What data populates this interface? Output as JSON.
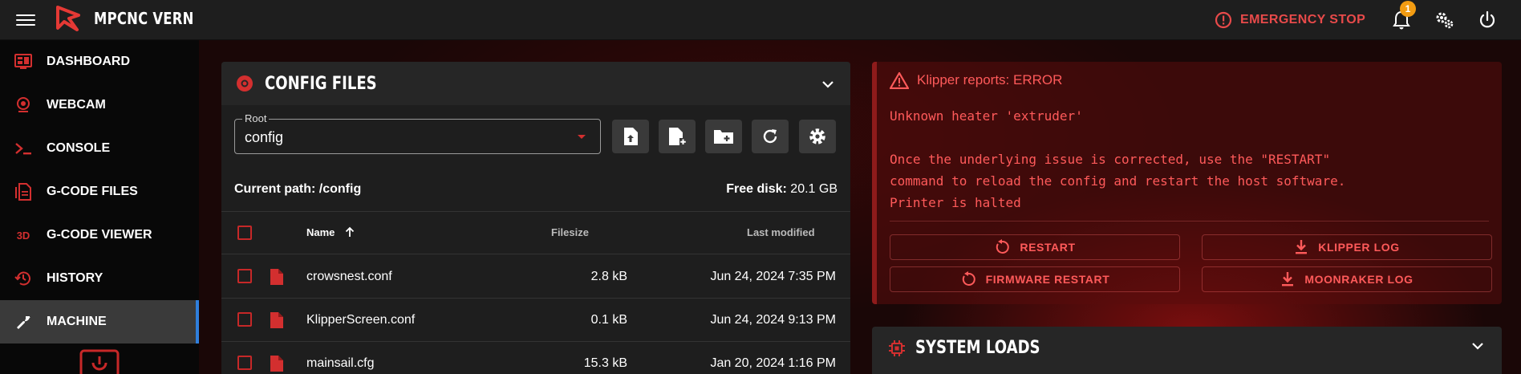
{
  "app": {
    "title": "MPCNC VERN"
  },
  "topbar": {
    "emergency_label": "EMERGENCY STOP",
    "notification_count": "1"
  },
  "sidebar": {
    "items": [
      {
        "label": "DASHBOARD",
        "icon": "dashboard-icon"
      },
      {
        "label": "WEBCAM",
        "icon": "webcam-icon"
      },
      {
        "label": "CONSOLE",
        "icon": "console-icon"
      },
      {
        "label": "G-CODE FILES",
        "icon": "gcode-files-icon"
      },
      {
        "label": "G-CODE VIEWER",
        "icon": "3d-icon",
        "icon_text": "3D"
      },
      {
        "label": "HISTORY",
        "icon": "history-icon"
      },
      {
        "label": "MACHINE",
        "icon": "wrench-icon",
        "active": true
      }
    ]
  },
  "config_panel": {
    "title": "CONFIG FILES",
    "root_label": "Root",
    "root_value": "config",
    "path_label": "Current path:",
    "path_value": "/config",
    "disk_label": "Free disk:",
    "disk_value": "20.1 GB",
    "columns": {
      "name": "Name",
      "size": "Filesize",
      "modified": "Last modified"
    },
    "files": [
      {
        "name": "crowsnest.conf",
        "size": "2.8 kB",
        "modified": "Jun 24, 2024 7:35 PM"
      },
      {
        "name": "KlipperScreen.conf",
        "size": "0.1 kB",
        "modified": "Jun 24, 2024 9:13 PM"
      },
      {
        "name": "mainsail.cfg",
        "size": "15.3 kB",
        "modified": "Jan 20, 2024 1:16 PM"
      }
    ]
  },
  "error_panel": {
    "title": "Klipper reports: ERROR",
    "lines": [
      "Unknown heater 'extruder'",
      "",
      "Once the underlying issue is corrected, use the \"RESTART\"",
      "command to reload the config and restart the host software.",
      "Printer is halted"
    ],
    "buttons": {
      "restart": "RESTART",
      "klipper_log": "KLIPPER LOG",
      "firmware_restart": "FIRMWARE RESTART",
      "moonraker_log": "MOONRAKER LOG"
    }
  },
  "loads_panel": {
    "title": "SYSTEM LOADS"
  },
  "colors": {
    "accent": "#d32f2f",
    "error_text": "#ff5a5a",
    "active_indicator": "#2f7fdc",
    "badge": "#f39c12"
  }
}
